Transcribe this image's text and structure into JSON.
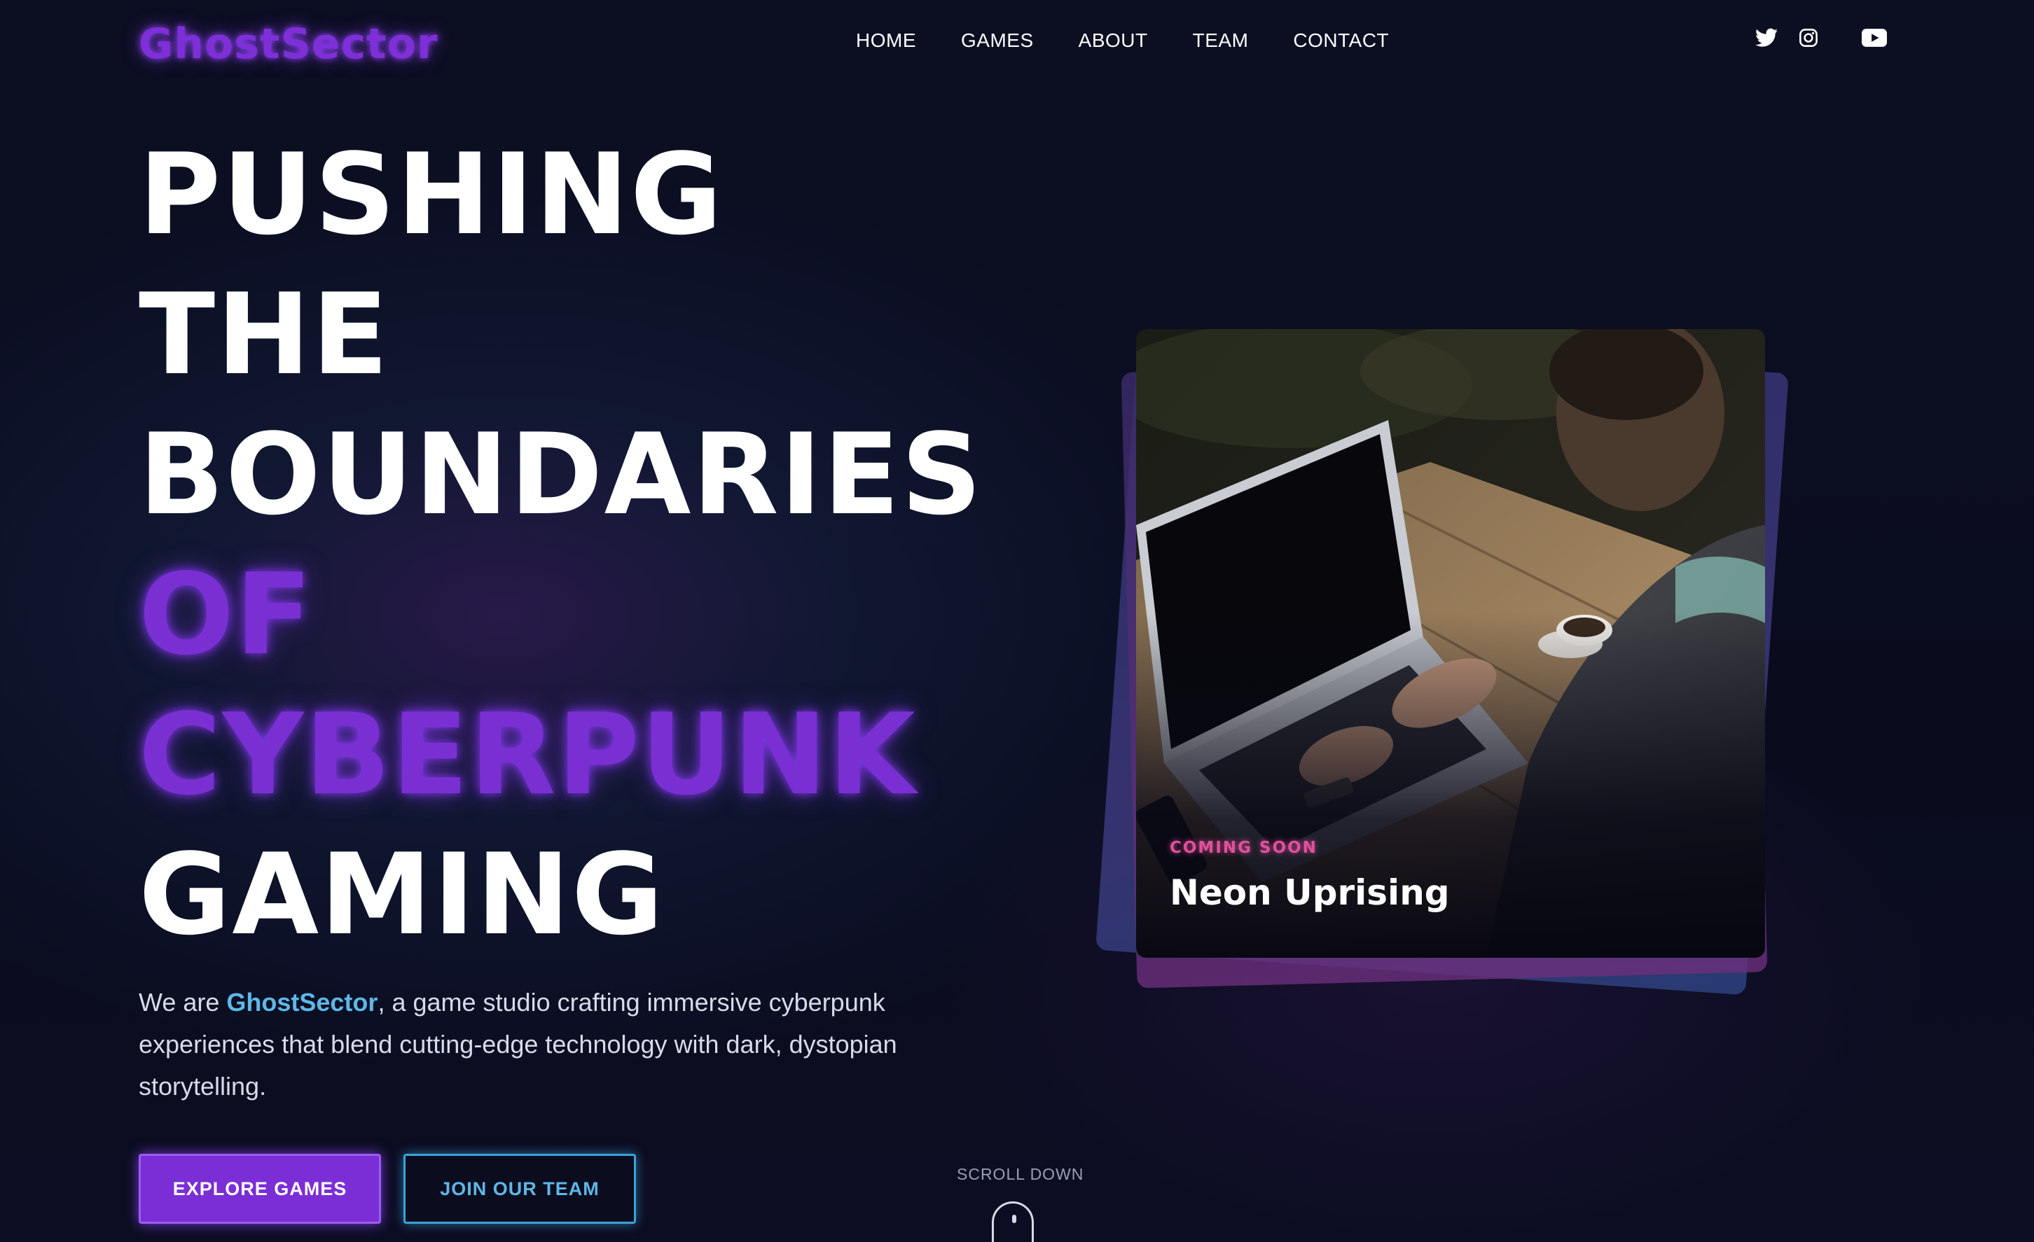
{
  "header": {
    "logo": "GhostSector",
    "nav": [
      {
        "label": "HOME"
      },
      {
        "label": "GAMES"
      },
      {
        "label": "ABOUT"
      },
      {
        "label": "TEAM"
      },
      {
        "label": "CONTACT"
      }
    ],
    "social_icons": [
      "twitter-icon",
      "instagram-icon",
      "youtube-icon"
    ]
  },
  "hero": {
    "headline": {
      "line1": "PUSHING",
      "line2": "THE",
      "line3": "BOUNDARIES",
      "line4": "OF",
      "line5": "CYBERPUNK",
      "line6": "GAMING"
    },
    "intro": {
      "prefix": "We are ",
      "brand": "GhostSector",
      "suffix": ", a game studio crafting immersive cyberpunk experiences that blend cutting-edge technology with dark, dystopian storytelling."
    },
    "buttons": {
      "primary": "EXPLORE GAMES",
      "secondary": "JOIN OUR TEAM"
    },
    "scroll_label": "SCROLL DOWN"
  },
  "feature_card": {
    "badge": "COMING SOON",
    "title": "Neon Uprising"
  },
  "colors": {
    "background": "#0b0d1f",
    "accent_purple": "#7b2ed6",
    "accent_cyan": "#5db8e6",
    "accent_pink": "#e0509c"
  }
}
